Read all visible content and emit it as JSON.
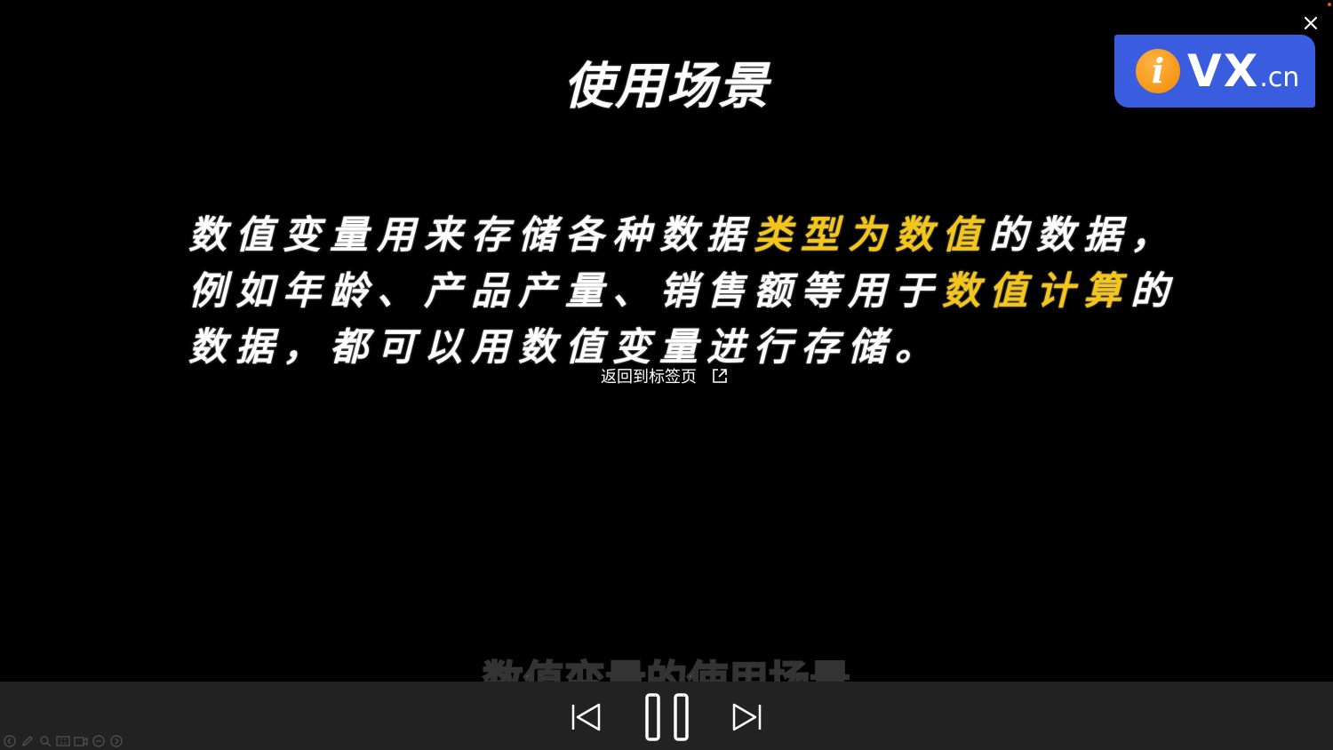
{
  "slide": {
    "title": "使用场景",
    "paragraph": [
      {
        "text": "数值变量用来存储各种数据",
        "highlight": false
      },
      {
        "text": "类型为数值",
        "highlight": true
      },
      {
        "text": "的数据，例如年龄、产品产量、销售额等用于",
        "highlight": false
      },
      {
        "text": "数值计算",
        "highlight": true
      },
      {
        "text": "的数据，都可以用数值变量进行存储。",
        "highlight": false
      }
    ],
    "highlight_color": "#f5c518"
  },
  "logo": {
    "letter": "i",
    "name": "VX",
    "suffix": ".cn"
  },
  "overlay": {
    "return_label": "返回到标签页"
  },
  "caption": {
    "text": "数值变量的使用场景"
  },
  "controls": {
    "prev": "previous-icon",
    "pause": "pause-icon",
    "next": "next-icon"
  },
  "toolbar": {
    "icons": [
      "back-icon",
      "pen-icon",
      "zoom-icon",
      "caption-icon",
      "camera-icon",
      "chat-icon",
      "forward-icon"
    ]
  }
}
